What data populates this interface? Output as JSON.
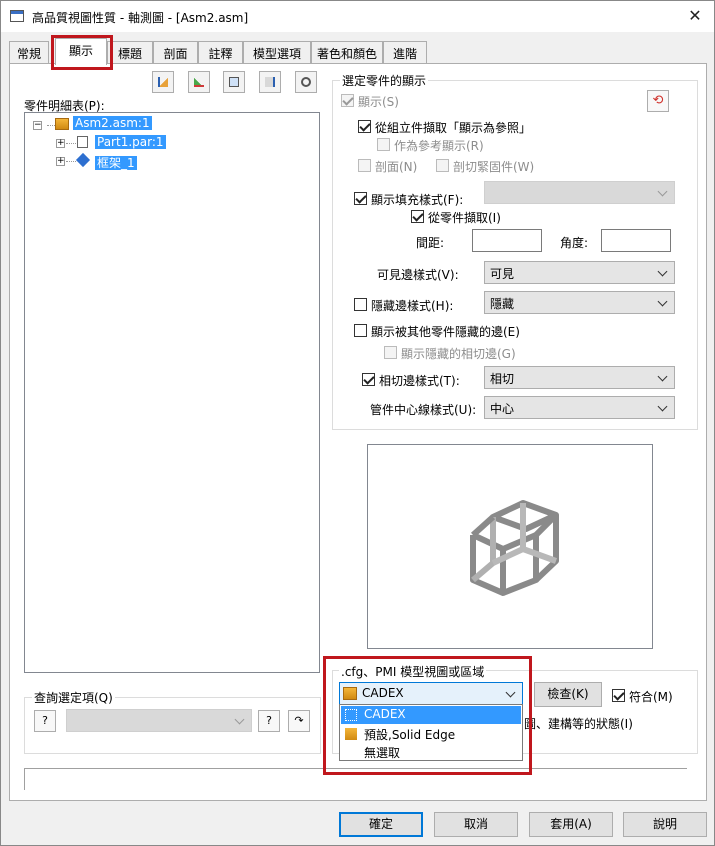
{
  "window": {
    "title": "高品質視圖性質 - 軸測圖 - [Asm2.asm]",
    "close_icon": "close-icon"
  },
  "tabs": [
    "常規",
    "顯示",
    "標題",
    "剖面",
    "註釋",
    "模型選項",
    "著色和顏色",
    "進階"
  ],
  "active_tab": "顯示",
  "toolbar_icons": [
    "show-parts-icon",
    "paint-icon",
    "properties-icon",
    "hide-parts-icon",
    "find-icon"
  ],
  "parts": {
    "label": "零件明細表(P):",
    "tree": [
      {
        "text": "Asm2.asm:1",
        "selected": true
      },
      {
        "text": "Part1.par:1",
        "selected": true
      },
      {
        "text": "框架_1",
        "selected": true
      }
    ]
  },
  "selected_display": {
    "group_title": "選定零件的顯示",
    "show": "顯示(S)",
    "from_asm": "從組立件擷取「顯示為參照」",
    "as_ref": "作為參考顯示(R)",
    "section": "剖面(N)",
    "section_fasteners": "剖切緊固件(W)",
    "fill_style": "顯示填充樣式(F):",
    "from_part": "從零件擷取(I)",
    "spacing": "間距:",
    "angle": "角度:",
    "visible_style_label": "可見邊樣式(V):",
    "visible_style_value": "可見",
    "hidden_style_label": "隱藏邊樣式(H):",
    "hidden_style_value": "隱藏",
    "show_hidden_by_others": "顯示被其他零件隱藏的邊(E)",
    "show_hidden_tangent": "顯示隱藏的相切邊(G)",
    "tangent_style_label": "相切邊樣式(T):",
    "tangent_style_value": "相切",
    "centerline_label": "管件中心線樣式(U):",
    "centerline_value": "中心"
  },
  "query": {
    "label": "查詢選定項(Q)"
  },
  "cfg": {
    "label": ".cfg、PMI 模型視圖或區域",
    "value": "CADEX",
    "check_button": "檢查(K)",
    "match": "符合(M)",
    "status_text": "圖、建構等的狀態(I)",
    "options": [
      "CADEX",
      "預設,Solid Edge",
      "無選取"
    ]
  },
  "buttons": {
    "ok": "確定",
    "cancel": "取消",
    "apply": "套用(A)",
    "help": "說明"
  },
  "colors": {
    "selection": "#3399ff",
    "highlight_box": "#c0171d",
    "default_button": "#0078d7"
  }
}
